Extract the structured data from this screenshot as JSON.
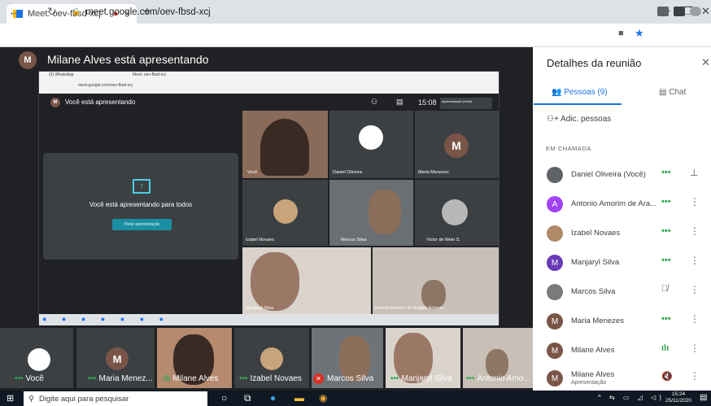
{
  "browser": {
    "tab_title": "Meet: oev-fbsd-xcj",
    "tab_recording_icon": "●",
    "tab_close": "×",
    "new_tab": "+",
    "win_minimize": "−",
    "win_restore": "❐",
    "win_close": "✕",
    "url": "meet.google.com/oev-fbsd-xcj"
  },
  "meet": {
    "presenter_initial": "M",
    "presenter_title": "Milane Alves está apresentando",
    "inner": {
      "tab1": "(3) WhatsApp",
      "tab2": "Meet: oev-fbsd-xcj",
      "url": "meet.google.com/oev-fbsd-xcj",
      "presenting_initial": "M",
      "presenting_text": "Você está apresentando",
      "time": "15:08",
      "badge": "Apresentação (Você)",
      "badge_you": "Você",
      "card_text": "Você está apresentando para todos",
      "stop_button": "Parar apresentação",
      "tiles": [
        {
          "label": "Você"
        },
        {
          "label": "Daniel Oliveira"
        },
        {
          "label": "Maria Menezes",
          "initial": "M"
        },
        {
          "label": "Izabel Novaes"
        },
        {
          "label": "Marcos Silva"
        },
        {
          "label": "Victor de Melo S."
        },
        {
          "label": "Manjaryl Silva"
        },
        {
          "label": "Antonio Amorim de Aragão Antonio"
        }
      ]
    },
    "strip": [
      {
        "label": "Você"
      },
      {
        "label": "Maria Menez...",
        "initial": "M"
      },
      {
        "label": "Milane Alves"
      },
      {
        "label": "Izabel Novaes"
      },
      {
        "label": "Marcos Silva"
      },
      {
        "label": "Manjaryl Silva"
      },
      {
        "label": "Antonio Amo..."
      }
    ]
  },
  "panel": {
    "title": "Detalhes da reunião",
    "close": "✕",
    "tab_people": "Pessoas (9)",
    "tab_chat": "Chat",
    "add_people": "Adic. pessoas",
    "section": "EM CHAMADA",
    "participants": [
      {
        "name": "Daniel Oliveira (Você)",
        "initial": "",
        "color": "#5f6368",
        "status": "speaking"
      },
      {
        "name": "Antonio Amorim de Ara...",
        "initial": "A",
        "color": "#a142f4",
        "status": "speaking"
      },
      {
        "name": "Izabel Novaes",
        "initial": "",
        "color": "#b08968",
        "status": "speaking"
      },
      {
        "name": "Manjaryl Silva",
        "initial": "M",
        "color": "#673ab7",
        "status": "speaking"
      },
      {
        "name": "Marcos Silva",
        "initial": "",
        "color": "#7a7a7a",
        "status": "muted"
      },
      {
        "name": "Maria Menezes",
        "initial": "M",
        "color": "#795548",
        "status": "speaking"
      },
      {
        "name": "Milane Alves",
        "initial": "M",
        "color": "#795548",
        "status": "active"
      },
      {
        "name": "Milane Alves",
        "sub": "Apresentação",
        "initial": "M",
        "color": "#795548",
        "status": "muted"
      }
    ]
  },
  "taskbar": {
    "search_placeholder": "Digite aqui para pesquisar",
    "time": "15:24",
    "date": "25/11/2020"
  }
}
